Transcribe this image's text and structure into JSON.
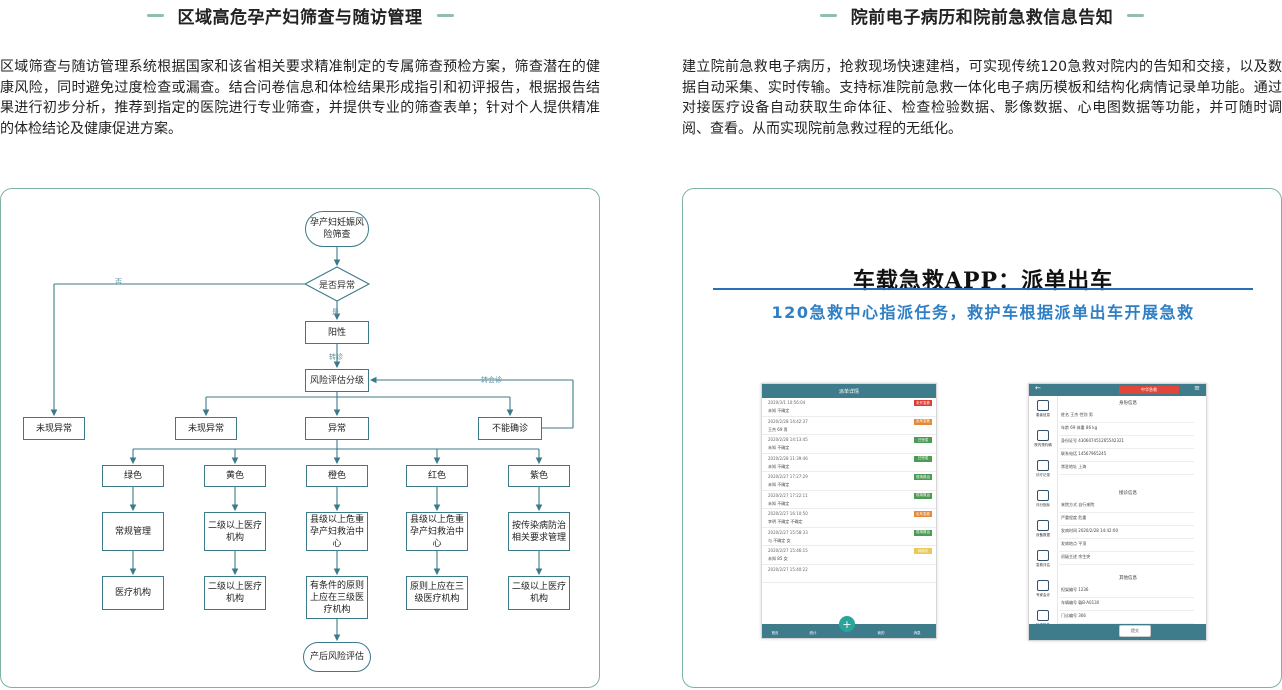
{
  "left": {
    "title": "区域高危孕产妇筛查与随访管理",
    "description": "区域筛查与随访管理系统根据国家和该省相关要求精准制定的专属筛查预检方案，筛查潜在的健康风险，同时避免过度检查或漏查。结合问卷信息和体检结果形成指引和初评报告，根据报告结果进行初步分析，推荐到指定的医院进行专业筛查，并提供专业的筛查表单；针对个人提供精准的体检结论及健康促进方案。",
    "flow": {
      "start": "孕产妇妊娠风险筛查",
      "decision": "是否异常",
      "label_no": "否",
      "label_yes": "是",
      "positive": "阳性",
      "label_referral": "转诊",
      "assess": "风险评估分级",
      "label_consult": "转会诊",
      "no_abnormal_1": "未现异常",
      "no_abnormal_2": "未现异常",
      "abnormal": "异常",
      "cannot_confirm": "不能确诊",
      "colors": [
        "绿色",
        "黄色",
        "橙色",
        "红色",
        "紫色"
      ],
      "actions": [
        "常规管理",
        "二级以上医疗机构",
        "县级以上危重孕产妇救治中心",
        "县级以上危重孕产妇救治中心",
        "按传染病防治相关要求管理"
      ],
      "facilities": [
        "医疗机构",
        "二级以上医疗机构",
        "有条件的原则上应在三级医疗机构",
        "原则上应在三级医疗机构",
        "二级以上医疗机构"
      ],
      "final": "产后风险评估"
    }
  },
  "right": {
    "title": "院前电子病历和院前急救信息告知",
    "description": "建立院前急救电子病历，抢救现场快速建档，可实现传统120急救对院内的告知和交接，以及数据自动采集、实时传输。支持标准院前急救一体化电子病历模板和结构化病情记录单功能。通过对接医疗设备自动获取生命体征、检查检验数据、影像数据、心电图数据等功能，并可随时调阅、查看。从而实现院前急救过程的无纸化。",
    "app_title": "车载急救APP：派单出车",
    "app_subtitle": "120急救中心指派任务，救护车根据派单出车开展急救",
    "phone1": {
      "header": "派单详情",
      "rows": [
        {
          "time": "2020/3/1 10:56:04",
          "info": "未知  不确定",
          "tag": "未开急救"
        },
        {
          "time": "2020/2/28 14:42:37",
          "info": "王杰  69  男",
          "tag": "出车急救"
        },
        {
          "time": "2020/2/28 14:13:45",
          "info": "未知  不确定",
          "tag": "已完成"
        },
        {
          "time": "2020/2/28 11:39:46",
          "info": "未知  不确定",
          "tag": "已完成"
        },
        {
          "time": "2020/2/27 17:27:29",
          "info": "未知  不确定",
          "tag": "现场救治"
        },
        {
          "time": "2020/2/27 17:22:11",
          "info": "未知  不确定",
          "tag": "现场救治"
        },
        {
          "time": "2020/2/27 16:10:50",
          "info": "李明  不确定  不确定",
          "tag": "出车急救"
        },
        {
          "time": "2020/2/27 15:58:33",
          "info": "与  不确定  女",
          "tag": "现场救治"
        },
        {
          "time": "2020/2/27 15:46:15",
          "info": "未知  85  女",
          "tag": "待接诊"
        },
        {
          "time": "2020/2/27 15:40:22",
          "info": "",
          "tag": ""
        }
      ],
      "nav": [
        "首页",
        "统计",
        "",
        "我的",
        "消息"
      ]
    },
    "phone2": {
      "header_badge": "中华急救",
      "section_identity": "身份信息",
      "section_disease": "接诊信息",
      "section_other": "其他信息",
      "fields": [
        "姓名  王杰        性别  男",
        "年龄  69          体重  86       kg",
        "身份证号  430607451265542321",
        "联系电话  14567965245",
        "常驻地址  上海"
      ],
      "disease_fields": [
        "来院方式  自行来院",
        "严重程度  危重",
        "发病时间  2020/2/28 14:42:00",
        "发病地点  平顶",
        "初级主述  余生突"
      ],
      "other_fields": [
        "担架编号  1236",
        "车辆编号  赣B·A0130",
        "门诊编号  366"
      ],
      "side": [
        "患者信息",
        "院内预约确",
        "诊疗记录",
        "评分指标",
        "设备数据",
        "急救评估",
        "专家会诊",
        "检查报告",
        "辅助决定"
      ],
      "button": "提交"
    }
  }
}
